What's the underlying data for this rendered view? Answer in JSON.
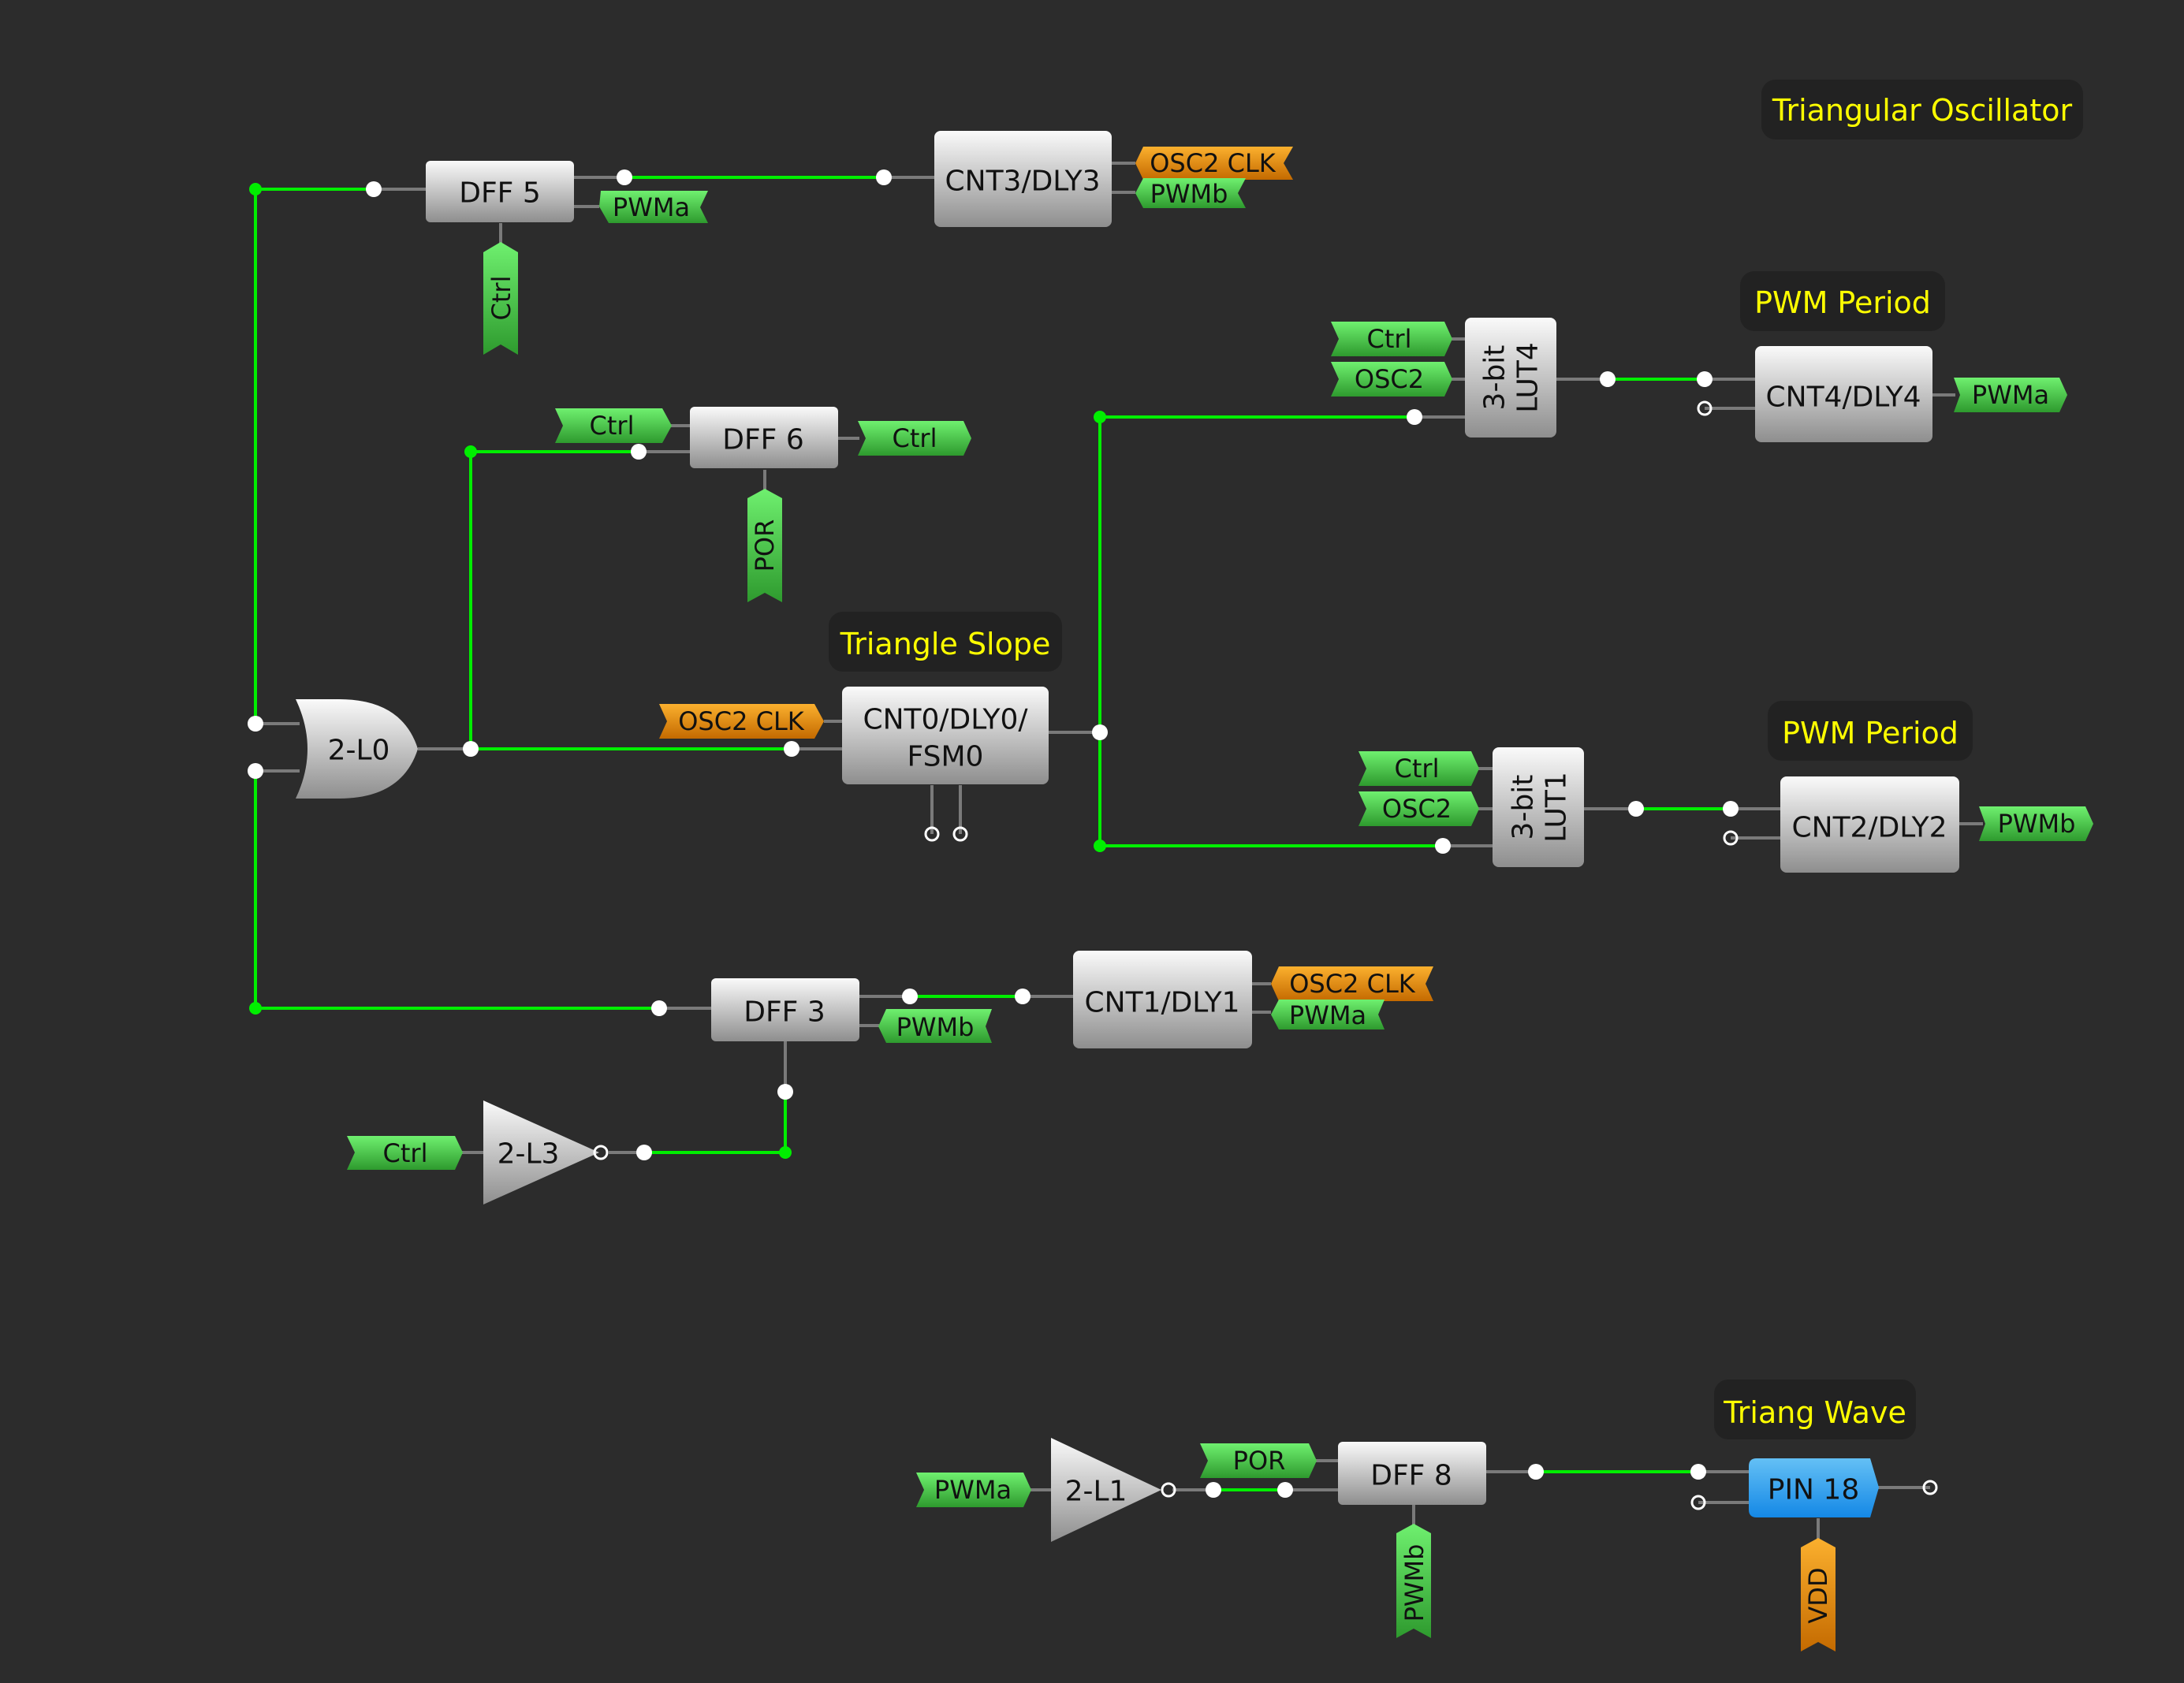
{
  "colors": {
    "background": "#2c2c2c",
    "active_wire": "#00ee00",
    "idle_wire": "#7a7a7a",
    "label_green": "#4fd04f",
    "label_orange": "#e8920f",
    "pin_blue": "#2a9bf0",
    "note_text": "#ffff00",
    "note_bg": "#222222"
  },
  "notes": {
    "triangular_oscillator": "Triangular Oscillator",
    "pwm_period_1": "PWM Period",
    "pwm_period_2": "PWM Period",
    "triangle_slope": "Triangle Slope",
    "triang_wave": "Triang Wave"
  },
  "blocks": {
    "dff5": "DFF 5",
    "dff6": "DFF 6",
    "dff3": "DFF 3",
    "dff8": "DFF 8",
    "cnt3": "CNT3/DLY3",
    "cnt4": "CNT4/DLY4",
    "cnt2": "CNT2/DLY2",
    "cnt1": "CNT1/DLY1",
    "cnt0_line1": "CNT0/DLY0/",
    "cnt0_line2": "FSM0",
    "lut4_line1": "3-bit",
    "lut4_line2": "LUT4",
    "lut1_line1": "3-bit",
    "lut1_line2": "LUT1",
    "or_gate": "2-L0",
    "inv_l3": "2-L3",
    "inv_l1": "2-L1",
    "pin18": "PIN 18"
  },
  "labels": {
    "dff5_out": "PWMa",
    "dff5_bottom": "Ctrl",
    "cnt3_out1": "OSC2 CLK",
    "cnt3_out2": "PWMb",
    "dff6_in": "Ctrl",
    "dff6_out": "Ctrl",
    "dff6_bottom": "POR",
    "lut4_in1": "Ctrl",
    "lut4_in2": "OSC2",
    "cnt4_out": "PWMa",
    "cnt0_in": "OSC2 CLK",
    "lut1_in1": "Ctrl",
    "lut1_in2": "OSC2",
    "cnt2_out": "PWMb",
    "dff3_out": "PWMb",
    "cnt1_out1": "OSC2 CLK",
    "cnt1_out2": "PWMa",
    "inv_l3_in": "Ctrl",
    "inv_l1_in": "PWMa",
    "dff8_in": "POR",
    "dff8_bottom": "PWMb",
    "pin18_bottom": "VDD"
  }
}
